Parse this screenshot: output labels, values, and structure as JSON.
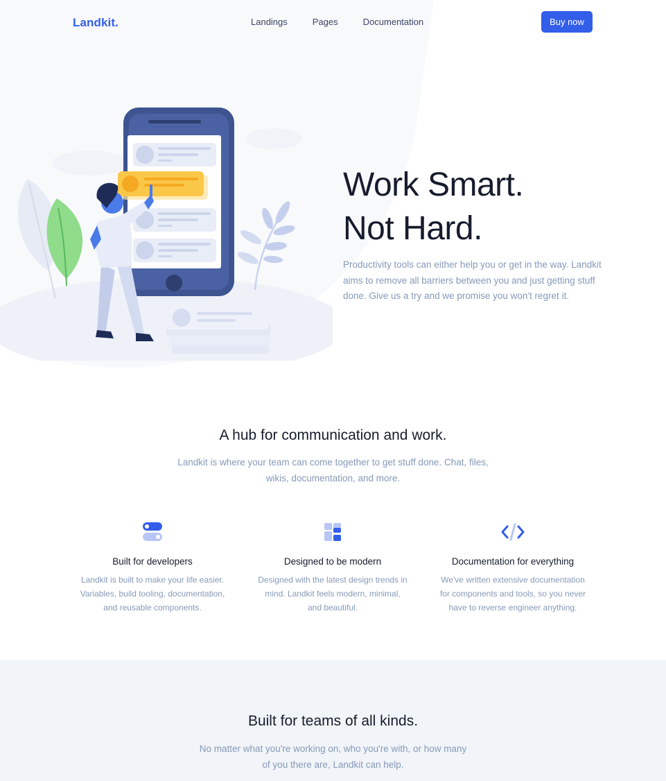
{
  "nav": {
    "logo": "Landkit.",
    "links": [
      "Landings",
      "Pages",
      "Documentation"
    ],
    "cta": "Buy now"
  },
  "hero": {
    "title_line1": "Work Smart.",
    "title_line2": "Not Hard.",
    "subtitle": "Productivity tools can either help you or get in the way. Landkit aims to remove all barriers between you and just getting stuff done. Give us a try and we promise you won't regret it."
  },
  "hub": {
    "title": "A hub for communication and work.",
    "subtitle_line1": "Landkit is where your team can come together to get stuff done. Chat, files,",
    "subtitle_line2": "wikis, documentation, and more."
  },
  "features": [
    {
      "icon": "toggle-icon",
      "title": "Built for developers",
      "desc_lines": [
        "Landkit is built to make your life easier.",
        "Variables, build tooling, documentation,",
        "and reusable components."
      ]
    },
    {
      "icon": "layout-icon",
      "title": "Designed to be modern",
      "desc_lines": [
        "Designed with the latest design trends in",
        "mind. Landkit feels modern, minimal,",
        "and beautiful."
      ]
    },
    {
      "icon": "code-icon",
      "title": "Documentation for everything",
      "desc_lines": [
        "We've written extensive documentation",
        "for components and tools, so you never",
        "have to reverse engineer anything."
      ]
    }
  ],
  "teams": {
    "title": "Built for teams of all kinds.",
    "subtitle_line1": "No matter what you're working on, who you're with, or how many",
    "subtitle_line2": "of you there are, Landkit can help."
  },
  "colors": {
    "primary": "#335eea",
    "heading": "#161c2d",
    "muted": "#869ab8",
    "section_bg": "#f1f4f8"
  }
}
